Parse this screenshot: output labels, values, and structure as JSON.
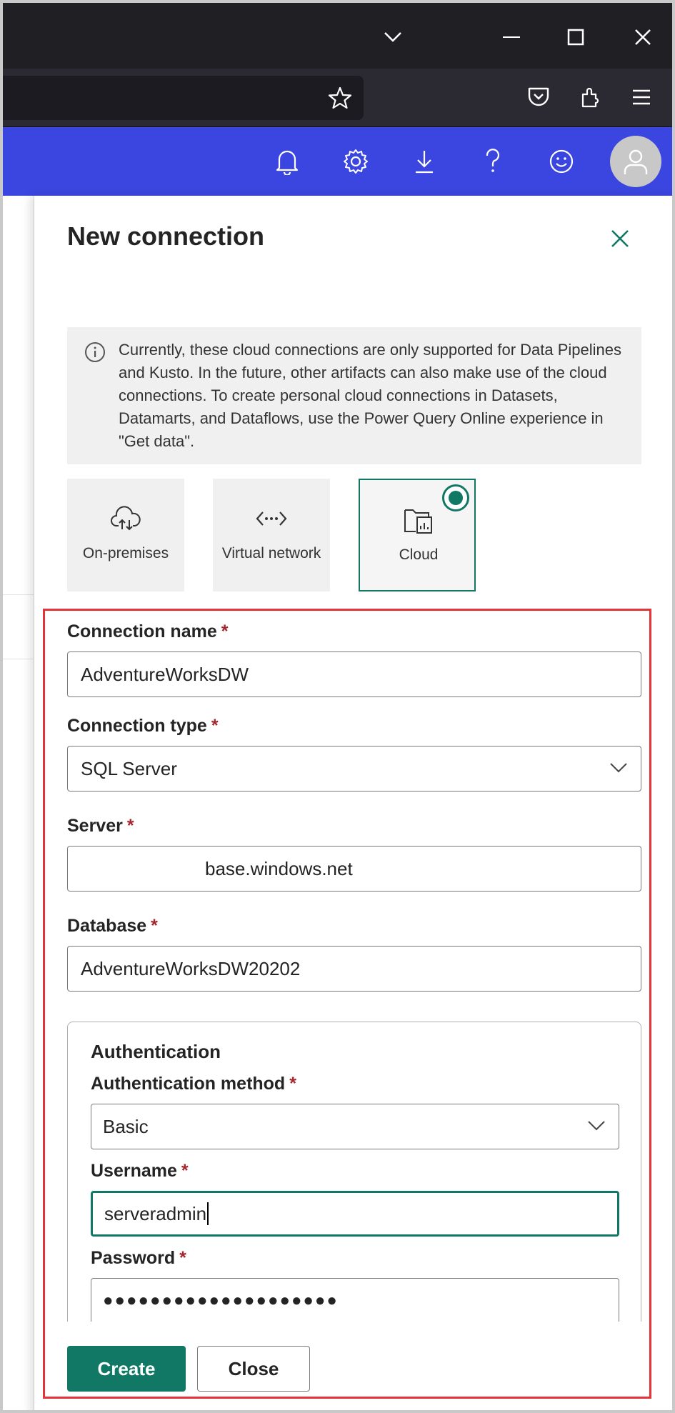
{
  "browser": {
    "title_icons": [
      "chevron-down-icon",
      "minimize-icon",
      "maximize-icon",
      "close-icon"
    ],
    "toolbar_icons": [
      "star-icon",
      "pocket-icon",
      "extensions-icon",
      "menu-icon"
    ]
  },
  "appbar": {
    "icons": [
      "bell-icon",
      "gear-icon",
      "download-icon",
      "help-icon",
      "smiley-icon"
    ],
    "accent": "#3b46e0"
  },
  "panel": {
    "title": "New connection",
    "info": "Currently, these cloud connections are only supported for Data Pipelines and Kusto. In the future, other artifacts can also make use of the cloud connections. To create personal cloud connections in Datasets, Datamarts, and Dataflows, use the Power Query Online experience in \"Get data\".",
    "tiles": [
      {
        "label": "On-premises",
        "icon": "cloud-upload-icon",
        "selected": false
      },
      {
        "label": "Virtual network",
        "icon": "network-icon",
        "selected": false
      },
      {
        "label": "Cloud",
        "icon": "cloud-report-icon",
        "selected": true
      }
    ]
  },
  "form": {
    "required_mark": "*",
    "connection_name": {
      "label": "Connection name",
      "value": "AdventureWorksDW"
    },
    "connection_type": {
      "label": "Connection type",
      "value": "SQL Server"
    },
    "server": {
      "label": "Server",
      "value": "base.windows.net"
    },
    "database": {
      "label": "Database",
      "value": "AdventureWorksDW20202"
    },
    "authentication": {
      "title": "Authentication",
      "method": {
        "label": "Authentication method",
        "value": "Basic"
      },
      "username": {
        "label": "Username",
        "value": "serveradmin"
      },
      "password": {
        "label": "Password",
        "value": "●●●●●●●●●●●●●●●●●●●●"
      }
    }
  },
  "buttons": {
    "create": "Create",
    "close": "Close"
  },
  "colors": {
    "primary": "#117865",
    "highlight": "#e5333a",
    "required": "#a4262c"
  }
}
